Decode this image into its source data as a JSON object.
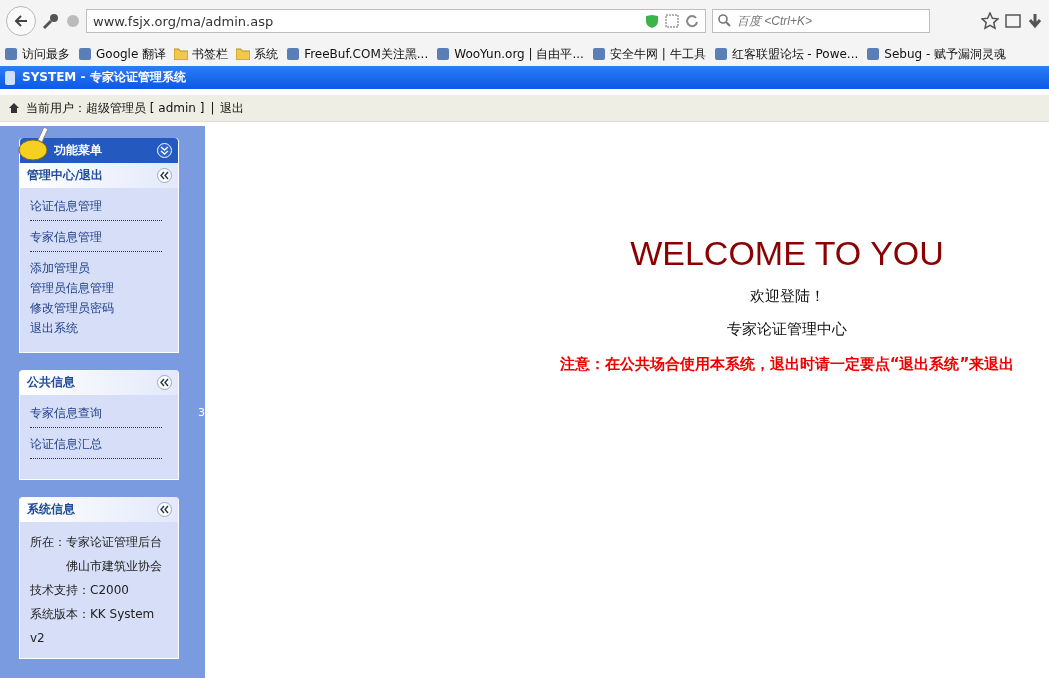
{
  "browser": {
    "url": "www.fsjx.org/ma/admin.asp",
    "search_placeholder": "百度 <Ctrl+K>",
    "bookmarks": [
      {
        "label": "访问最多",
        "kind": "site"
      },
      {
        "label": "Google 翻译",
        "kind": "site"
      },
      {
        "label": "书签栏",
        "kind": "folder"
      },
      {
        "label": "系统",
        "kind": "folder"
      },
      {
        "label": "FreeBuf.COM关注黑...",
        "kind": "site"
      },
      {
        "label": "WooYun.org | 自由平...",
        "kind": "site"
      },
      {
        "label": "安全牛网 | 牛工具",
        "kind": "site"
      },
      {
        "label": "红客联盟论坛 - Powe...",
        "kind": "site"
      },
      {
        "label": "Sebug - 赋予漏洞灵魂",
        "kind": "site"
      }
    ]
  },
  "app": {
    "title": "SYSTEM - 专家论证管理系统",
    "user_bar": {
      "current_user": "当前用户：超级管理员 [ admin ]",
      "separator": "|",
      "logout": "退出"
    },
    "menu": {
      "title": "功能菜单",
      "sections": [
        {
          "title": "管理中心/退出",
          "items": [
            {
              "label": "论证信息管理",
              "divider": true
            },
            {
              "label": "专家信息管理",
              "divider": true
            },
            {
              "label": "添加管理员",
              "divider": false
            },
            {
              "label": "管理员信息管理",
              "divider": false
            },
            {
              "label": "修改管理员密码",
              "divider": false
            },
            {
              "label": "退出系统",
              "divider": false
            }
          ]
        },
        {
          "title": "公共信息",
          "items": [
            {
              "label": "专家信息查询",
              "divider": true
            },
            {
              "label": "论证信息汇总",
              "divider": true
            }
          ]
        }
      ],
      "system_info": {
        "title": "系统信息",
        "lines": [
          {
            "text": "所在：专家论证管理后台",
            "indented": false
          },
          {
            "text": "佛山市建筑业协会",
            "indented": true
          },
          {
            "text": "技术支持：C2000",
            "indented": false
          },
          {
            "text": "系统版本：KK System",
            "indented": false
          },
          {
            "text": "v2",
            "indented": false
          }
        ]
      }
    },
    "splitter_label": "3",
    "welcome": {
      "heading": "WELCOME TO YOU",
      "greeting": "欢迎登陆！",
      "center": "专家论证管理中心",
      "notice": "注意：在公共场合使用本系统，退出时请一定要点“退出系统”来退出"
    }
  }
}
